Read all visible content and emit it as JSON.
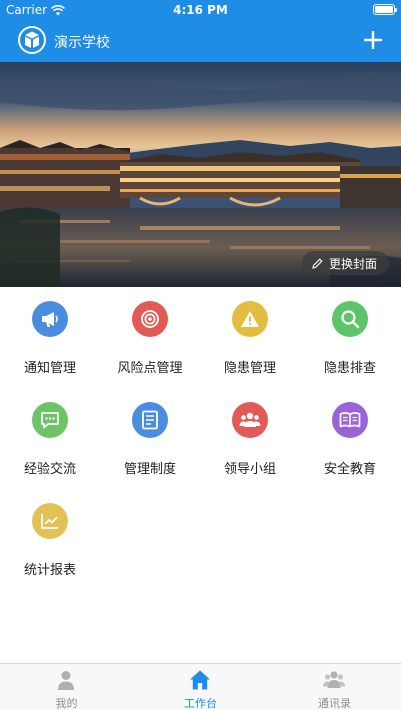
{
  "status_bar": {
    "carrier": "Carrier",
    "time": "4:16 PM"
  },
  "nav": {
    "title": "演示学校"
  },
  "banner": {
    "change_cover_label": "更换封面"
  },
  "grid": [
    {
      "label": "通知管理",
      "color": "#4a8de0",
      "icon": "megaphone-icon"
    },
    {
      "label": "风险点管理",
      "color": "#e25a55",
      "icon": "target-icon"
    },
    {
      "label": "隐患管理",
      "color": "#e3bd40",
      "icon": "warning-icon"
    },
    {
      "label": "隐患排查",
      "color": "#5ec46a",
      "icon": "search-icon"
    },
    {
      "label": "经验交流",
      "color": "#6cc466",
      "icon": "chat-icon"
    },
    {
      "label": "管理制度",
      "color": "#4a8de0",
      "icon": "document-icon"
    },
    {
      "label": "领导小组",
      "color": "#e25a55",
      "icon": "group-icon"
    },
    {
      "label": "安全教育",
      "color": "#9a64d8",
      "icon": "book-icon"
    },
    {
      "label": "统计报表",
      "color": "#e3c154",
      "icon": "chart-icon"
    }
  ],
  "tabs": [
    {
      "label": "我的",
      "icon": "person-icon",
      "active": false
    },
    {
      "label": "工作台",
      "icon": "home-icon",
      "active": true
    },
    {
      "label": "通讯录",
      "icon": "contacts-icon",
      "active": false
    }
  ],
  "colors": {
    "brand": "#1f8ce6",
    "tab_inactive": "#8e8e8e"
  }
}
